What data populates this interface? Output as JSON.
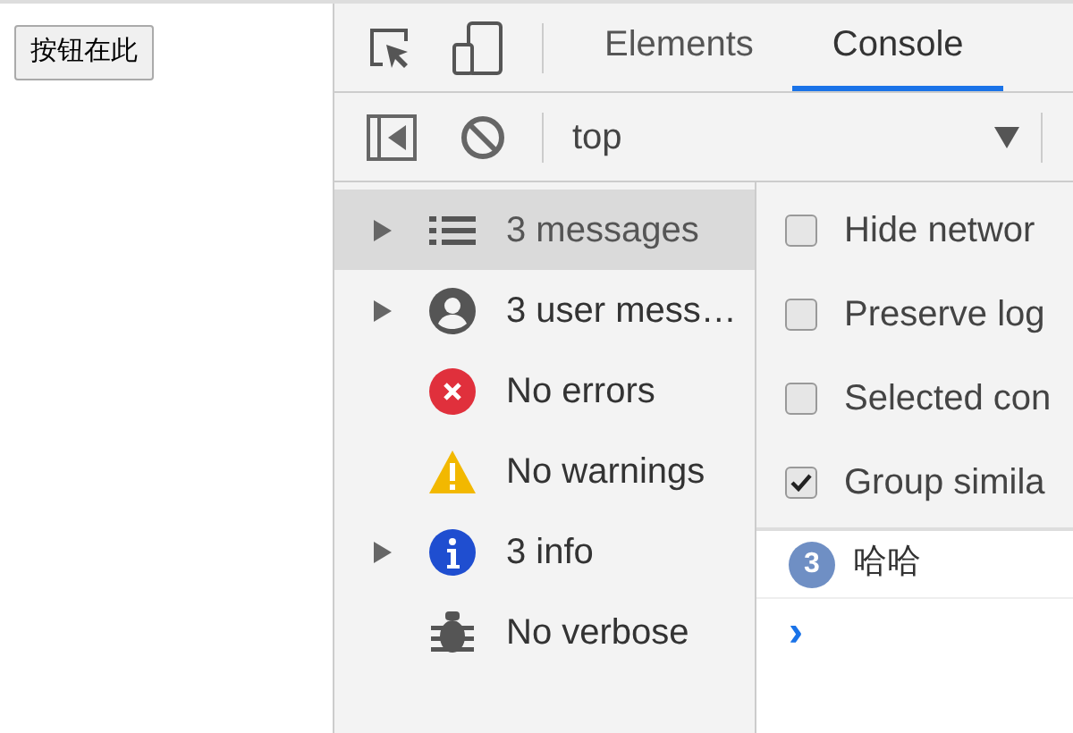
{
  "page": {
    "button": "按钮在此"
  },
  "tabs": [
    {
      "label": "Elements",
      "selected": false
    },
    {
      "label": "Console",
      "selected": true
    }
  ],
  "toolbar": {
    "context": "top"
  },
  "sidebar": {
    "items": [
      {
        "kind": "list",
        "label": "3 messages",
        "expandable": true,
        "selected": true
      },
      {
        "kind": "user",
        "label": "3 user mess…",
        "expandable": true,
        "selected": false
      },
      {
        "kind": "error",
        "label": "No errors",
        "expandable": false,
        "selected": false
      },
      {
        "kind": "warning",
        "label": "No warnings",
        "expandable": false,
        "selected": false
      },
      {
        "kind": "info",
        "label": "3 info",
        "expandable": true,
        "selected": false
      },
      {
        "kind": "verbose",
        "label": "No verbose",
        "expandable": false,
        "selected": false
      }
    ]
  },
  "settings": [
    {
      "label": "Hide networ",
      "checked": false
    },
    {
      "label": "Preserve log",
      "checked": false
    },
    {
      "label": "Selected con",
      "checked": false
    },
    {
      "label": "Group simila",
      "checked": true
    }
  ],
  "console": {
    "messages": [
      {
        "count": "3",
        "text": "哈哈"
      }
    ],
    "prompt": "›"
  }
}
